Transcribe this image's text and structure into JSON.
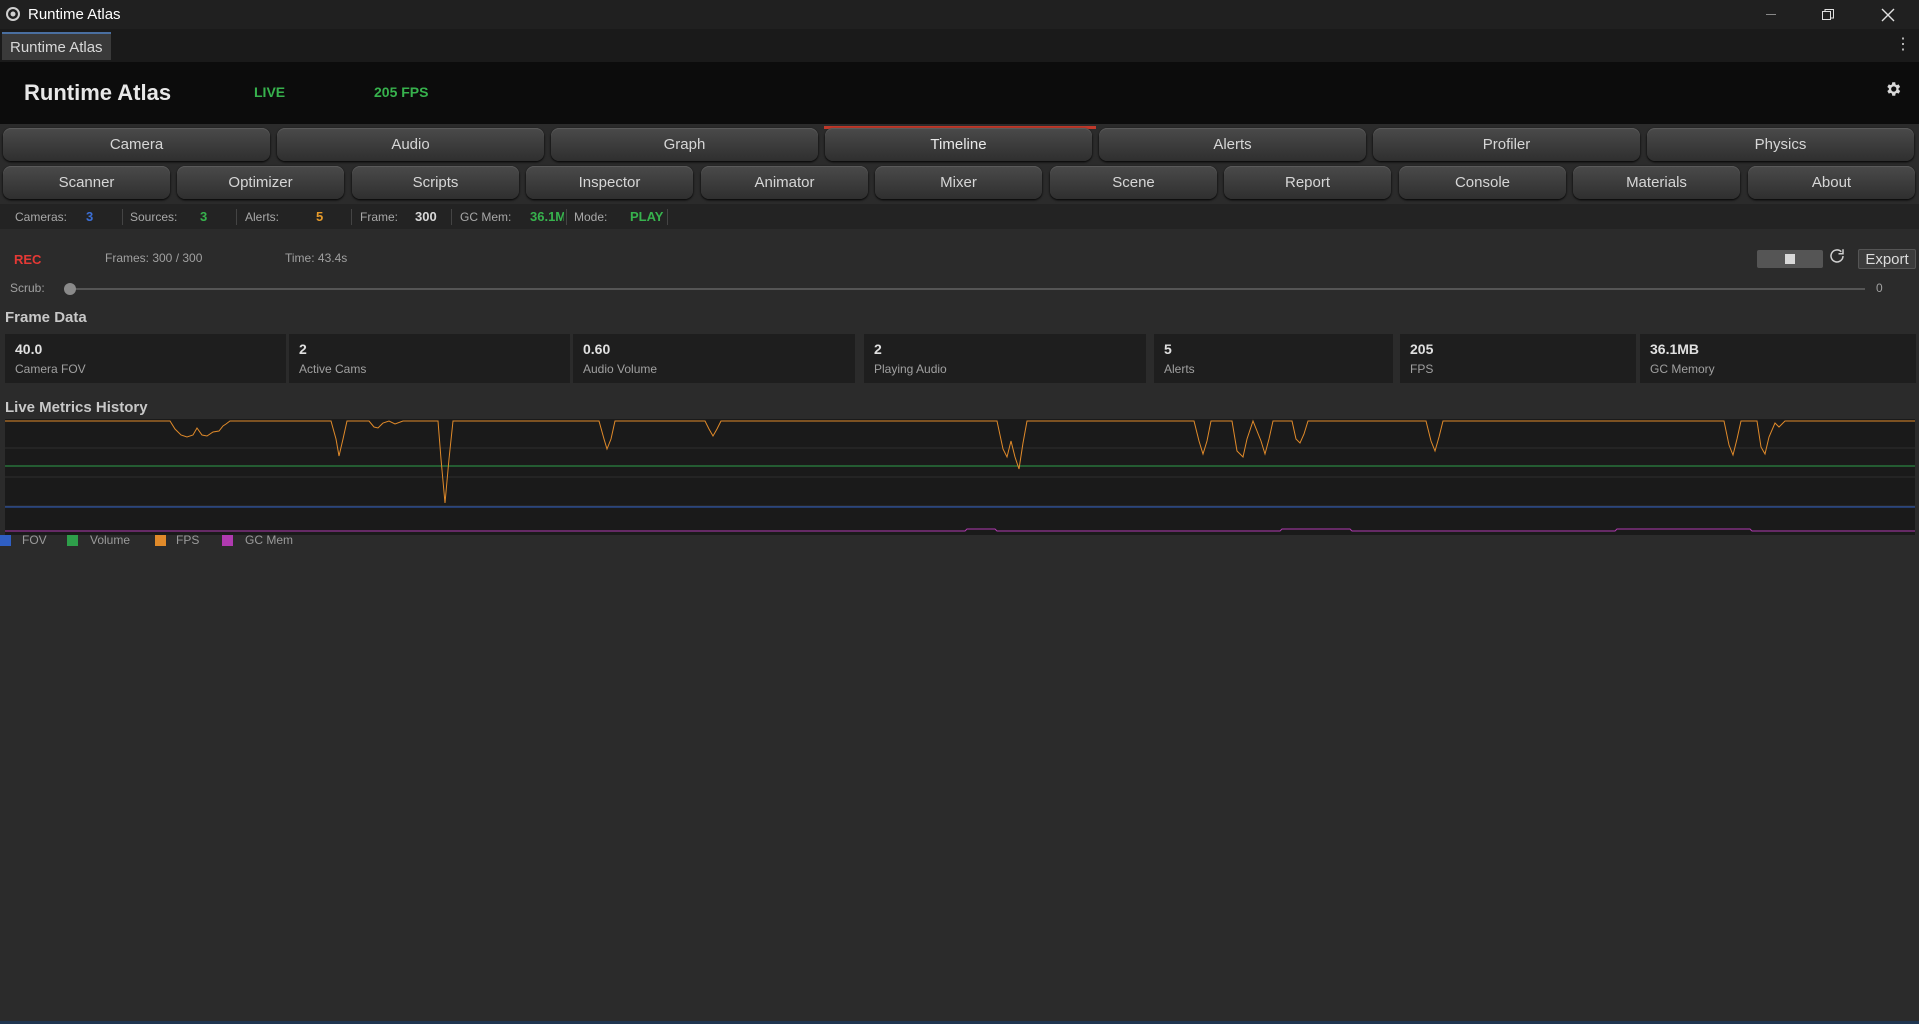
{
  "window": {
    "title": "Runtime Atlas",
    "tab": "Runtime Atlas"
  },
  "header": {
    "app_name": "Runtime Atlas",
    "live": "LIVE",
    "fps": "205 FPS"
  },
  "nav_row1": [
    "Camera",
    "Audio",
    "Graph",
    "Timeline",
    "Alerts",
    "Profiler",
    "Physics"
  ],
  "nav_row2": [
    "Scanner",
    "Optimizer",
    "Scripts",
    "Inspector",
    "Animator",
    "Mixer",
    "Scene",
    "Report",
    "Console",
    "Materials",
    "About"
  ],
  "active_nav": "Timeline",
  "stats": {
    "cameras_label": "Cameras:",
    "cameras": "3",
    "sources_label": "Sources:",
    "sources": "3",
    "alerts_label": "Alerts:",
    "alerts": "5",
    "frame_label": "Frame:",
    "frame": "300",
    "gcmem_label": "GC Mem:",
    "gcmem": "36.1M",
    "mode_label": "Mode:",
    "mode": "PLAY"
  },
  "recorder": {
    "rec": "REC",
    "frames": "Frames: 300 / 300",
    "time": "Time: 43.4s",
    "export": "Export",
    "scrub_label": "Scrub:",
    "scrub_value": "0",
    "scrub_position": 0
  },
  "frame_data": {
    "title": "Frame Data",
    "cards": [
      {
        "value": "40.0",
        "label": "Camera FOV"
      },
      {
        "value": "2",
        "label": "Active Cams"
      },
      {
        "value": "0.60",
        "label": "Audio Volume"
      },
      {
        "value": "2",
        "label": "Playing Audio"
      },
      {
        "value": "5",
        "label": "Alerts"
      },
      {
        "value": "205",
        "label": "FPS"
      },
      {
        "value": "36.1MB",
        "label": "GC Memory"
      }
    ]
  },
  "metrics": {
    "title": "Live Metrics History",
    "legend": [
      {
        "name": "FOV",
        "color": "#2f5fc4"
      },
      {
        "name": "Volume",
        "color": "#2e9e4a"
      },
      {
        "name": "FPS",
        "color": "#e08a2a"
      },
      {
        "name": "GC Mem",
        "color": "#b03ab0"
      }
    ]
  },
  "colors": {
    "live_green": "#37b24d",
    "rec_red": "#e53935",
    "cameras_blue": "#3b6fd6",
    "alerts_orange": "#e69a2a"
  }
}
